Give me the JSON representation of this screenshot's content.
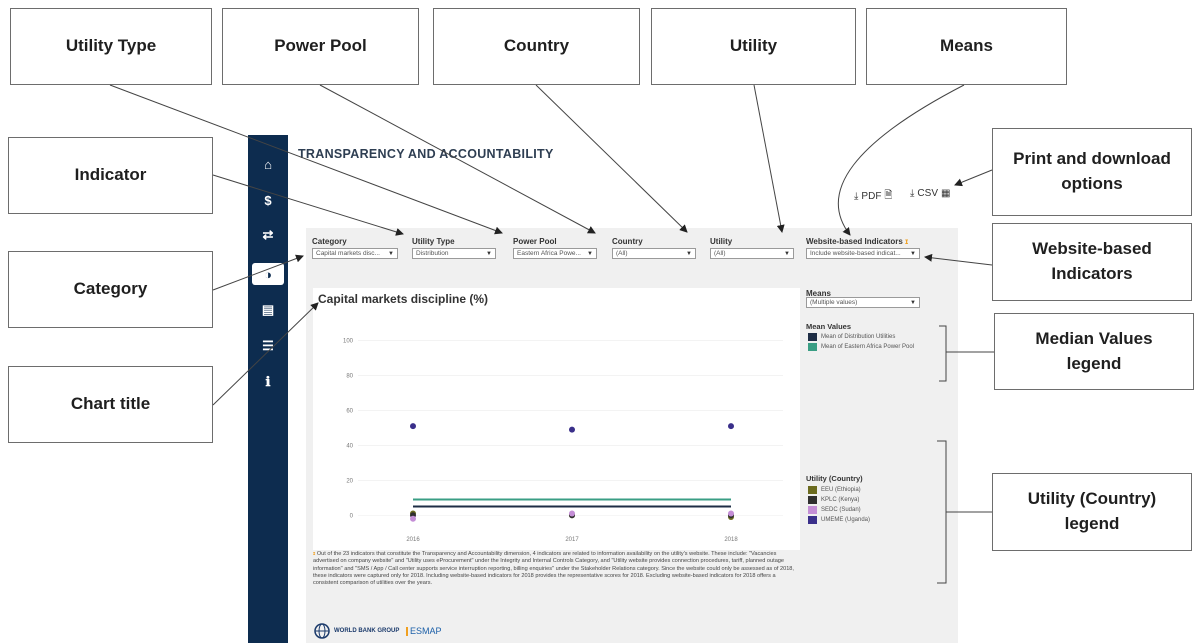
{
  "callouts": {
    "utility_type": "Utility Type",
    "power_pool": "Power Pool",
    "country": "Country",
    "utility": "Utility",
    "means": "Means",
    "indicator": "Indicator",
    "print_download_line1": "Print and download",
    "print_download_line2": "options",
    "category": "Category",
    "website_line1": "Website-based",
    "website_line2": "Indicators",
    "median_line1": "Median Values",
    "median_line2": "legend",
    "chart_title": "Chart title",
    "utility_country_line1": "Utility (Country)",
    "utility_country_line2": "legend"
  },
  "sidebar": {
    "icons": [
      "home-icon",
      "dollar-icon",
      "shuffle-icon",
      "pie-icon",
      "document-icon",
      "list-icon",
      "info-icon"
    ],
    "glyphs": [
      "⌂",
      "$",
      "⇄",
      "◑",
      "▤",
      "☰",
      "ℹ"
    ]
  },
  "dashboard": {
    "title": "TRANSPARENCY AND ACCOUNTABILITY",
    "pdf_label": "PDF",
    "csv_label": "CSV"
  },
  "filters": {
    "category": {
      "label": "Category",
      "value": "Capital markets disc..."
    },
    "utility_type": {
      "label": "Utility Type",
      "value": "Distribution"
    },
    "power_pool": {
      "label": "Power Pool",
      "value": "Eastern Africa Powe..."
    },
    "country": {
      "label": "Country",
      "value": "(All)"
    },
    "utility": {
      "label": "Utility",
      "value": "(All)"
    },
    "website": {
      "label": "Website-based Indicators",
      "value": "Include website-based indicat..."
    },
    "means": {
      "label": "Means",
      "value": "(Multiple values)"
    }
  },
  "legend": {
    "mean_title": "Mean Values",
    "mean_items": [
      {
        "label": "Mean of Distribution Utilities",
        "color": "#1e2d45"
      },
      {
        "label": "Mean of Eastern Africa Power Pool",
        "color": "#3a9e84"
      }
    ],
    "utility_title": "Utility (Country)",
    "utility_items": [
      {
        "label": "EEU (Ethiopia)",
        "color": "#6b6b1f"
      },
      {
        "label": "KPLC (Kenya)",
        "color": "#2f2f2f"
      },
      {
        "label": "SEDC (Sudan)",
        "color": "#c48ed6"
      },
      {
        "label": "UMEME (Uganda)",
        "color": "#3a2f8a"
      }
    ]
  },
  "chart_data": {
    "type": "scatter",
    "title": "Capital markets discipline (%)",
    "x": [
      "2016",
      "2017",
      "2018"
    ],
    "yticks": [
      0,
      20,
      40,
      60,
      80,
      100
    ],
    "ylim": [
      -5,
      110
    ],
    "mean_lines": [
      {
        "name": "Mean of Distribution Utilities",
        "value": 5,
        "color": "#1e2d45"
      },
      {
        "name": "Mean of Eastern Africa Power Pool",
        "value": 9,
        "color": "#3a9e84"
      }
    ],
    "series": [
      {
        "name": "EEU (Ethiopia)",
        "color": "#6b6b1f",
        "values": [
          1,
          0,
          -1
        ]
      },
      {
        "name": "KPLC (Kenya)",
        "color": "#2f2f2f",
        "values": [
          0,
          0,
          0
        ]
      },
      {
        "name": "SEDC (Sudan)",
        "color": "#c48ed6",
        "values": [
          -2,
          1,
          1
        ]
      },
      {
        "name": "UMEME (Uganda)",
        "color": "#3a2f8a",
        "values": [
          51,
          49,
          51
        ]
      }
    ]
  },
  "footnote": "Out of the 23 indicators that constitute the Transparency and Accountability dimension, 4 indicators are related to information availability on the utility's website. These include: \"Vacancies advertised on company website\" and \"Utility uses eProcurement\" under the Integrity and Internal Controls Category, and \"Utility website provides connection procedures, tariff, planned outage information\" and \"SMS / App / Call center supports service interruption reporting, billing enquiries\" under the Stakeholder Relations category. Since the website could only be assessed as of 2018, these indicators were captured only for 2018. Including website-based indicators for 2018 provides the representative scores for 2018. Excluding website-based indicators for 2018 offers a consistent comparison of utilities over the years.",
  "logos": {
    "world_bank": "WORLD BANK GROUP",
    "esmap": "ESMAP"
  }
}
